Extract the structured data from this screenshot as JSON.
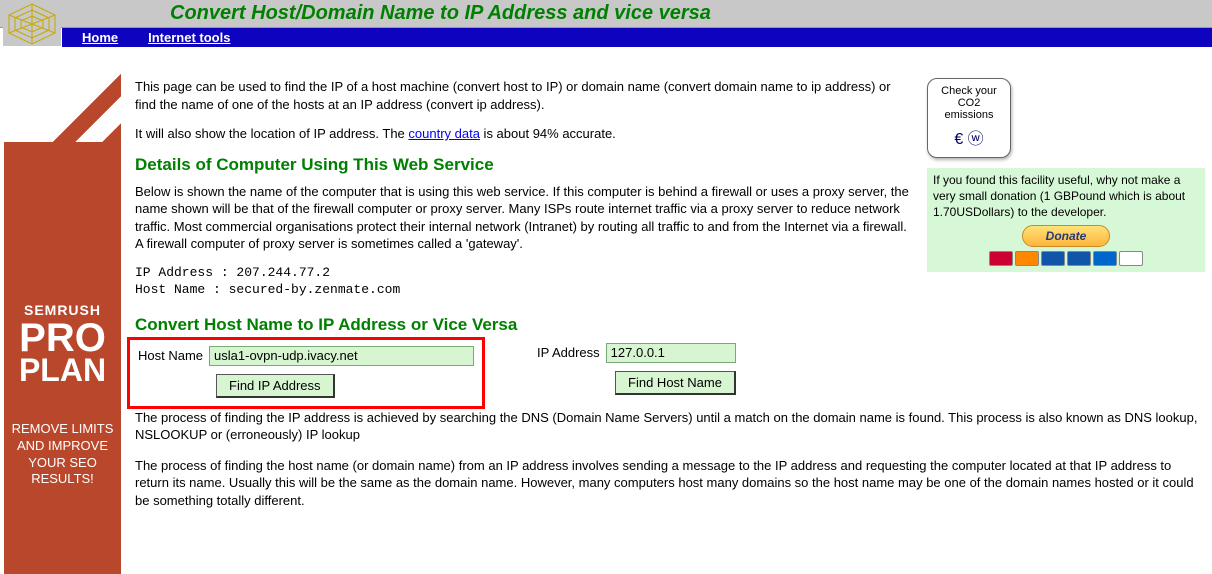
{
  "header": {
    "title": "Convert Host/Domain Name to IP Address and vice versa",
    "nav": {
      "home": "Home",
      "tools": "Internet tools"
    }
  },
  "sideAd": {
    "line1": "SEMRUSH",
    "line2": "PRO",
    "line3": "PLAN",
    "desc": "REMOVE LIMITS AND IMPROVE YOUR SEO RESULTS!"
  },
  "intro": {
    "p1": "This page can be used to find the IP of a host machine (convert host to IP) or domain name (convert domain name to ip address) or find the name of one of the hosts at an IP address (convert ip address).",
    "p2a": "It will also show the location of IP address. The ",
    "p2_link": "country data",
    "p2b": " is about 94% accurate."
  },
  "detailsHeading": "Details of Computer Using This Web Service",
  "detailsPara": "Below is shown the name of the computer that is using this web service. If this computer is behind a firewall or uses a proxy server, the name shown will be that of the firewall computer or proxy server. Many ISPs route internet traffic via a proxy server to reduce network traffic. Most commercial organisations protect their internal network (Intranet) by routing all traffic to and from the Internet via a firewall. A firewall computer of proxy server is sometimes called a 'gateway'.",
  "client": {
    "ipLine": "IP Address : 207.244.77.2",
    "hostLine": "Host Name  : secured-by.zenmate.com"
  },
  "convertHeading": "Convert Host Name to IP Address or Vice Versa",
  "form": {
    "hostLabel": "Host Name",
    "hostValue": "usla1-ovpn-udp.ivacy.net",
    "findIpBtn": "Find IP Address",
    "ipLabel": "IP Address",
    "ipValue": "127.0.0.1",
    "findHostBtn": "Find Host Name"
  },
  "processPara1": "The process of finding the IP address is achieved by searching the DNS (Domain Name Servers) until a match on the domain name is found. This process is also known as DNS lookup, NSLOOKUP or (erroneously) IP lookup",
  "processPara2": "The process of finding the host name (or domain name) from an IP address involves sending a message to the IP address and requesting the computer located at that IP address to return its name. Usually this will be the same as the domain name. However, many computers host many domains so the host name may be one of the domain names hosted or it could be something totally different.",
  "right": {
    "co2_l1": "Check your",
    "co2_l2": "CO2",
    "co2_l3": "emissions",
    "donateText": "If you found this facility useful, why not make a very small donation (1 GBPound which is about 1.70USDollars) to the developer.",
    "donateBtn": "Donate"
  }
}
